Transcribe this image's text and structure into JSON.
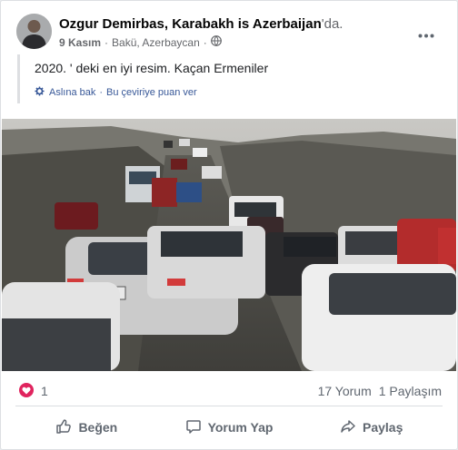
{
  "post": {
    "author_name": "Ozgur Demirbas",
    "author_sep": ",",
    "group_name": "Karabakh is Azerbaijan",
    "group_suffix": "'da.",
    "date": "9 Kasım",
    "location": "Bakü, Azerbaycan",
    "privacy_icon": "globe-icon",
    "text": "2020. ' deki en iyi resim. Kaçan Ermeniler",
    "see_original": "Aslına bak",
    "rate_translation": "Bu çeviriye puan ver"
  },
  "stats": {
    "reaction_icon": "heart-icon",
    "reaction_count": "1",
    "comments": "17 Yorum",
    "shares": "1 Paylaşım"
  },
  "actions": {
    "like": "Beğen",
    "comment": "Yorum Yap",
    "share": "Paylaş"
  },
  "colors": {
    "link": "#385898",
    "heart": "#e0245e",
    "muted": "#606770"
  }
}
